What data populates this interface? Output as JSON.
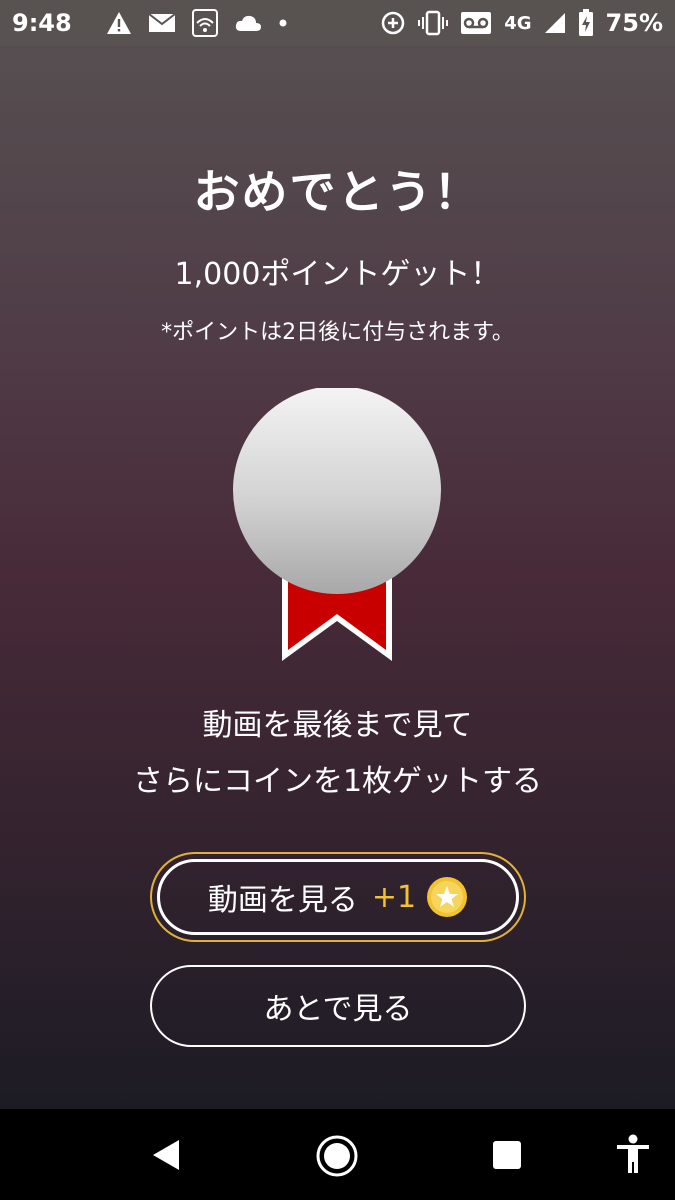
{
  "status_bar": {
    "time": "9:48",
    "network": "4G",
    "battery": "75%",
    "icons": [
      "warning-icon",
      "mail-icon",
      "wifi-icon",
      "cloud-icon",
      "dot-icon",
      "data-saver-icon",
      "vibrate-icon",
      "voicemail-icon",
      "signal-icon",
      "battery-charging-icon"
    ]
  },
  "dialog": {
    "title": "おめでとう！",
    "points": "1,000ポイントゲット！",
    "note": "*ポイントは2日後に付与されます。",
    "message_line1": "動画を最後まで見て",
    "message_line2": "さらにコインを1枚ゲットする"
  },
  "buttons": {
    "watch_label": "動画を見る",
    "watch_bonus": "+1",
    "later_label": "あとで見る"
  },
  "colors": {
    "accent_gold": "#f2c230",
    "ribbon_red": "#c80000",
    "medal_silver": "#cfcfcf"
  },
  "nav": {
    "icons": [
      "back-icon",
      "home-icon",
      "recents-icon",
      "accessibility-icon"
    ]
  }
}
